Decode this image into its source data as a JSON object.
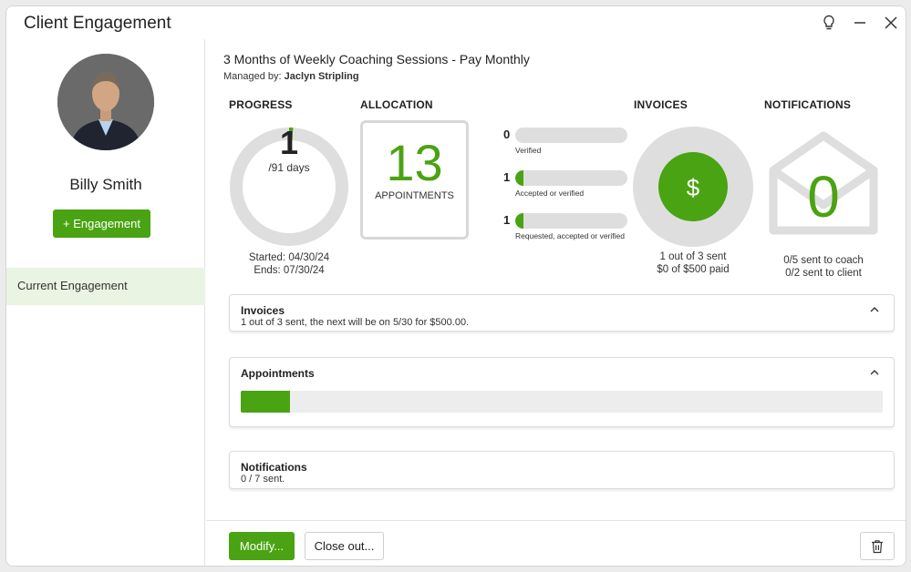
{
  "window": {
    "title": "Client Engagement"
  },
  "client": {
    "name": "Billy Smith",
    "add_engagement_label": "+ Engagement"
  },
  "sidebar": {
    "items": [
      {
        "label": "Current Engagement"
      }
    ]
  },
  "engagement": {
    "title": "3 Months of Weekly Coaching Sessions - Pay Monthly",
    "managed_by_label": "Managed by:",
    "manager": "Jaclyn Stripling"
  },
  "progress": {
    "heading": "PROGRESS",
    "value": "1",
    "total_label": "/91 days",
    "started": "Started: 04/30/24",
    "ends": "Ends: 07/30/24",
    "fraction": 0.011
  },
  "allocation": {
    "heading": "ALLOCATION",
    "count": "13",
    "label": "APPOINTMENTS",
    "rows": [
      {
        "count": "0",
        "caption": "Verified",
        "fraction": 0
      },
      {
        "count": "1",
        "caption": "Accepted or verified",
        "fraction": 0.077
      },
      {
        "count": "1",
        "caption": "Requested, accepted or verified",
        "fraction": 0.077
      }
    ]
  },
  "invoices": {
    "heading": "INVOICES",
    "symbol": "$",
    "sent": "1 out of 3 sent",
    "paid": "$0 of $500 paid"
  },
  "notifications": {
    "heading": "NOTIFICATIONS",
    "count": "0",
    "coach": "0/5 sent to coach",
    "client": "0/2 sent to client"
  },
  "panels": {
    "invoices": {
      "title": "Invoices",
      "subtitle": "1 out of 3 sent, the next will be on 5/30 for $500.00."
    },
    "appointments": {
      "title": "Appointments",
      "fraction": 0.077
    },
    "notifications": {
      "title": "Notifications",
      "subtitle": "0 / 7 sent."
    }
  },
  "footer": {
    "modify_label": "Modify...",
    "close_out_label": "Close out..."
  },
  "colors": {
    "accent": "#4aa312",
    "track": "#dedede",
    "selected_bg": "#eaf4e3"
  }
}
